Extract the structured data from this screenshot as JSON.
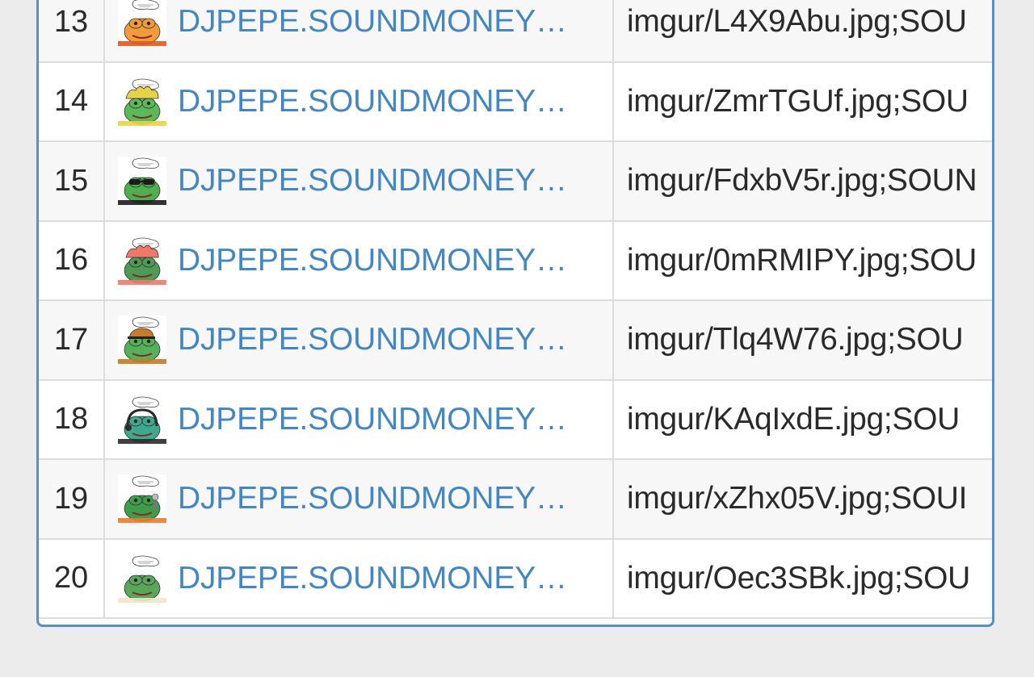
{
  "rows": [
    {
      "num": "13",
      "name": "DJPEPE.SOUNDMONEY…",
      "image": "imgur/L4X9Abu.jpg;SOU",
      "thumb": {
        "skin": "#f29b3a",
        "accent": "#e2561f",
        "item": "none"
      }
    },
    {
      "num": "14",
      "name": "DJPEPE.SOUNDMONEY…",
      "image": "imgur/ZmrTGUf.jpg;SOU",
      "thumb": {
        "skin": "#5db85a",
        "accent": "#e6d34a",
        "item": "hair"
      }
    },
    {
      "num": "15",
      "name": "DJPEPE.SOUNDMONEY…",
      "image": "imgur/FdxbV5r.jpg;SOUN",
      "thumb": {
        "skin": "#4fae4f",
        "accent": "#1c1c1c",
        "item": "shades"
      }
    },
    {
      "num": "16",
      "name": "DJPEPE.SOUNDMONEY…",
      "image": "imgur/0mRMIPY.jpg;SOU",
      "thumb": {
        "skin": "#4f9a55",
        "accent": "#f0786a",
        "item": "hair"
      }
    },
    {
      "num": "17",
      "name": "DJPEPE.SOUNDMONEY…",
      "image": "imgur/Tlq4W76.jpg;SOU",
      "thumb": {
        "skin": "#56b05a",
        "accent": "#c9792a",
        "item": "cap"
      }
    },
    {
      "num": "18",
      "name": "DJPEPE.SOUNDMONEY…",
      "image": "imgur/KAqIxdE.jpg;SOU",
      "thumb": {
        "skin": "#3fa88e",
        "accent": "#2b2b2b",
        "item": "headset"
      }
    },
    {
      "num": "19",
      "name": "DJPEPE.SOUNDMONEY…",
      "image": "imgur/xZhx05V.jpg;SOUI",
      "thumb": {
        "skin": "#3f9d4a",
        "accent": "#ee7b2a",
        "item": "mic"
      }
    },
    {
      "num": "20",
      "name": "DJPEPE.SOUNDMONEY…",
      "image": "imgur/Oec3SBk.jpg;SOU",
      "thumb": {
        "skin": "#5aa75a",
        "accent": "#f3e7c8",
        "item": "none"
      }
    }
  ],
  "colors": {
    "link": "#4386c2",
    "panel_border": "#5b8ec4",
    "row_divider": "#dcdcdc"
  },
  "icons": {
    "thumbnail": "pepe-thumbnail-icon"
  }
}
